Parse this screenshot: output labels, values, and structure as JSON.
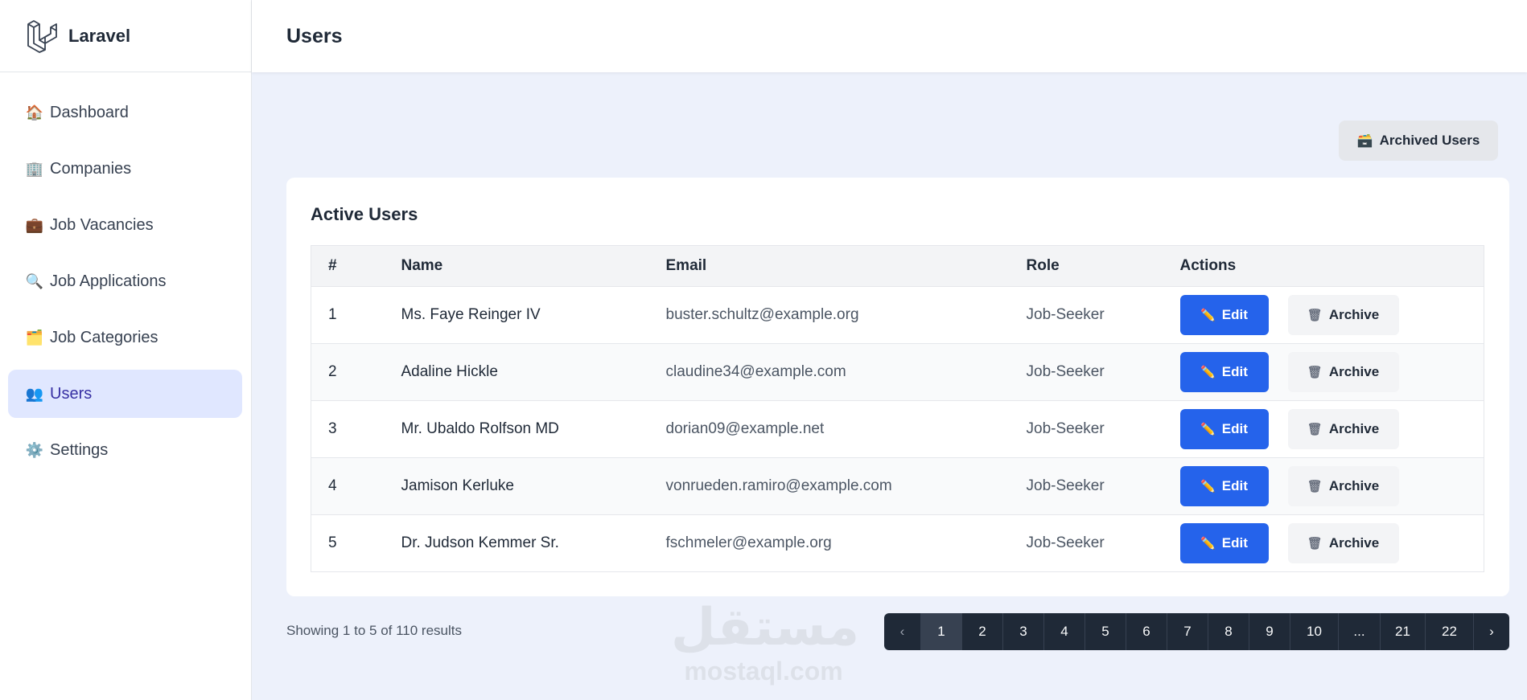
{
  "app": {
    "brand": "Laravel",
    "page_title": "Users"
  },
  "sidebar": {
    "items": [
      {
        "icon": "🏠",
        "label": "Dashboard"
      },
      {
        "icon": "🏢",
        "label": "Companies"
      },
      {
        "icon": "💼",
        "label": "Job Vacancies"
      },
      {
        "icon": "🔍",
        "label": "Job Applications"
      },
      {
        "icon": "🗂️",
        "label": "Job Categories"
      },
      {
        "icon": "👥",
        "label": "Users"
      },
      {
        "icon": "⚙️",
        "label": "Settings"
      }
    ],
    "active_index": 5
  },
  "toolbar": {
    "archived_icon": "🗃️",
    "archived_label": "Archived Users"
  },
  "table": {
    "title": "Active Users",
    "headers": [
      "#",
      "Name",
      "Email",
      "Role",
      "Actions"
    ],
    "edit_label": "Edit",
    "archive_label": "Archive",
    "rows": [
      {
        "num": "1",
        "name": "Ms. Faye Reinger IV",
        "email": "buster.schultz@example.org",
        "role": "Job-Seeker"
      },
      {
        "num": "2",
        "name": "Adaline Hickle",
        "email": "claudine34@example.com",
        "role": "Job-Seeker"
      },
      {
        "num": "3",
        "name": "Mr. Ubaldo Rolfson MD",
        "email": "dorian09@example.net",
        "role": "Job-Seeker"
      },
      {
        "num": "4",
        "name": "Jamison Kerluke",
        "email": "vonrueden.ramiro@example.com",
        "role": "Job-Seeker"
      },
      {
        "num": "5",
        "name": "Dr. Judson Kemmer Sr.",
        "email": "fschmeler@example.org",
        "role": "Job-Seeker"
      }
    ]
  },
  "pagination": {
    "showing": "Showing 1 to 5 of 110 results",
    "pages": [
      "1",
      "2",
      "3",
      "4",
      "5",
      "6",
      "7",
      "8",
      "9",
      "10",
      "...",
      "21",
      "22"
    ],
    "current": "1",
    "prev_icon": "‹",
    "next_icon": "›"
  },
  "watermark": {
    "arabic": "مستقل",
    "latin": "mostaql.com"
  },
  "colors": {
    "primary": "#2563eb",
    "active_nav_bg": "#e0e7ff",
    "page_bg": "#edf1fb",
    "pagination_bg": "#1f2937"
  }
}
